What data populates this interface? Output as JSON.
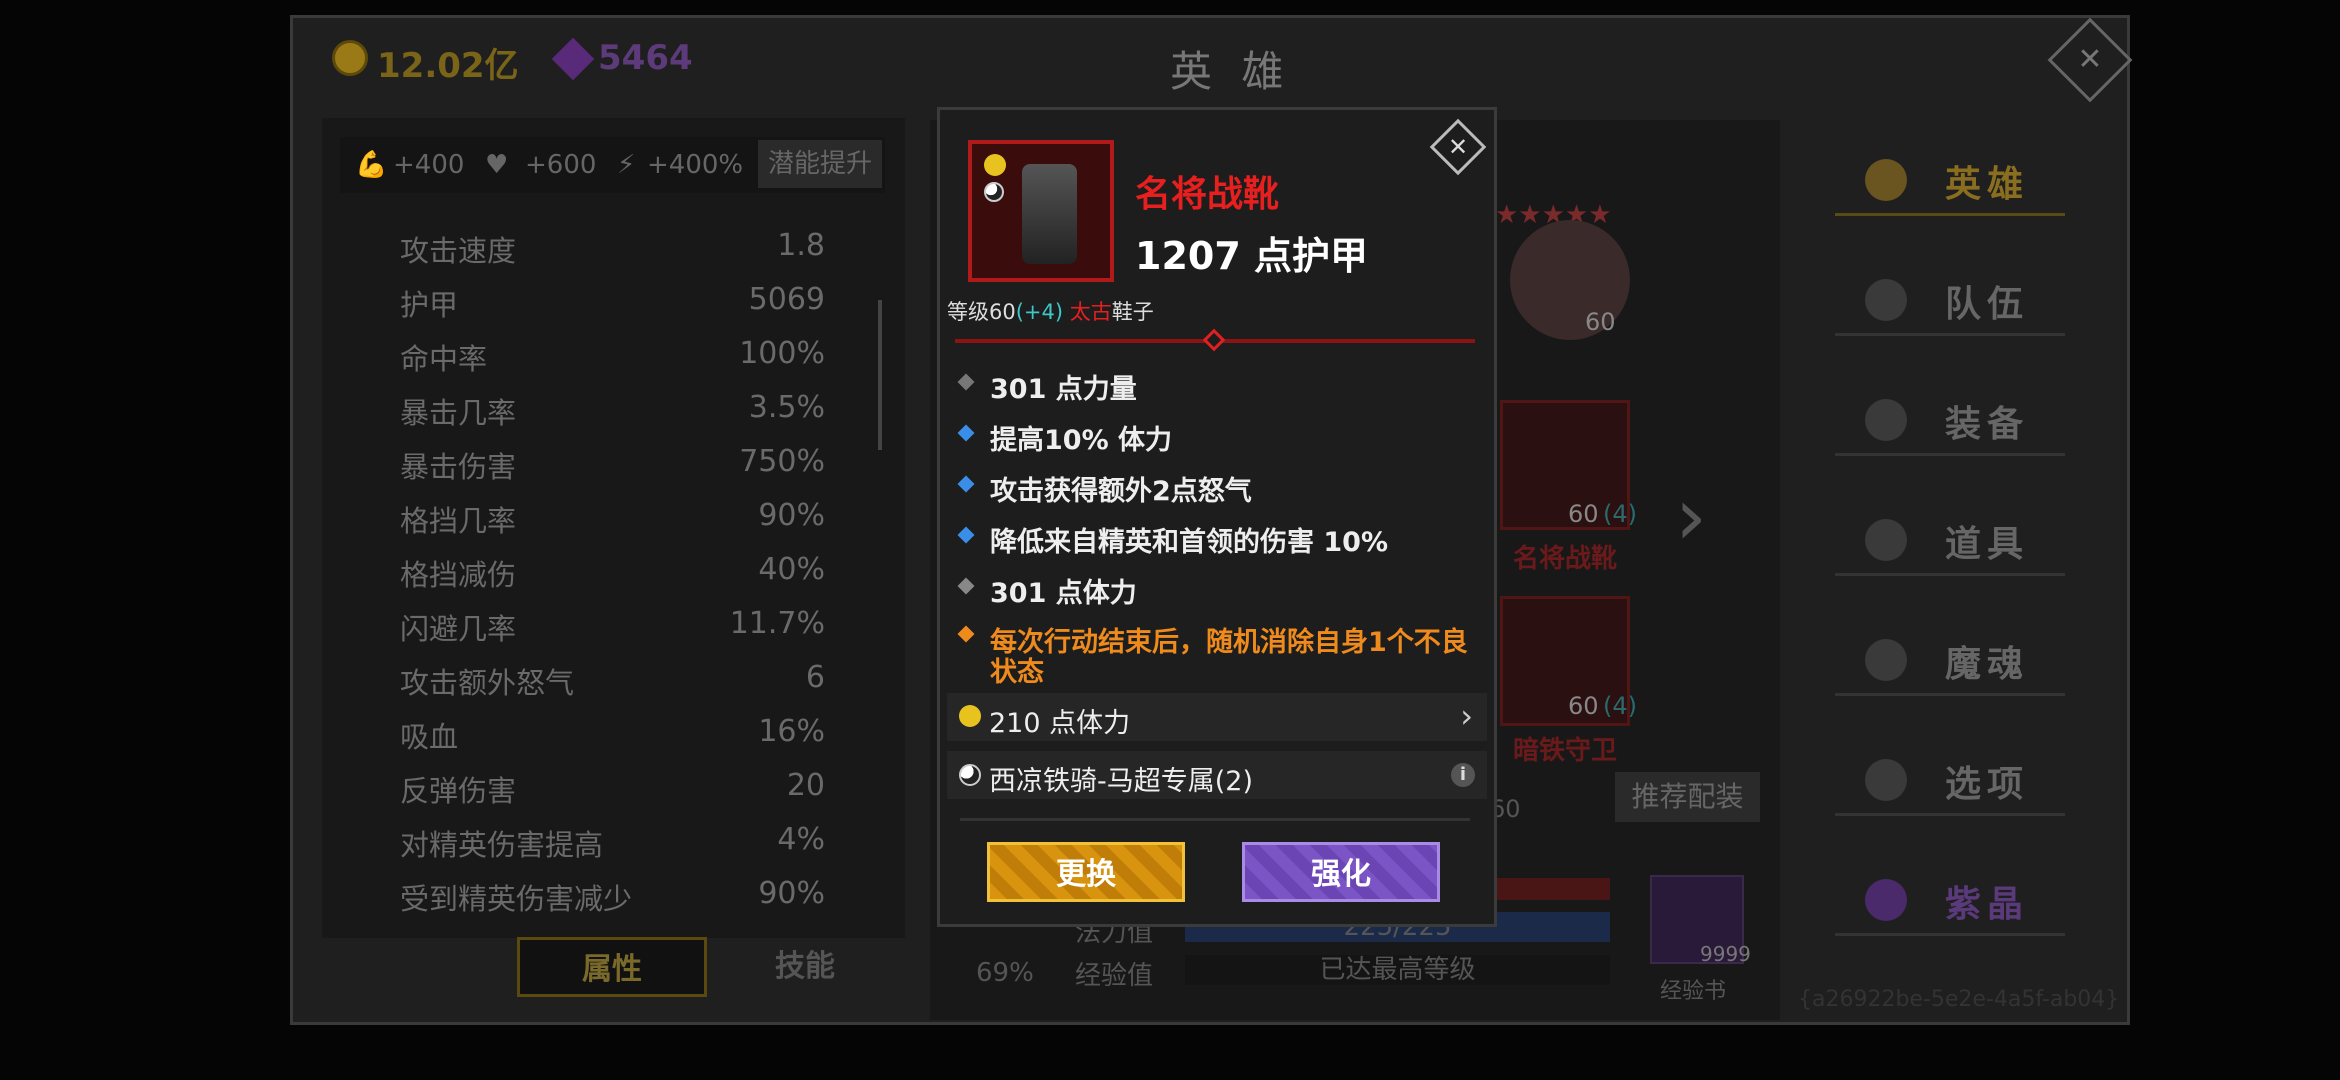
{
  "header": {
    "title": "英 雄",
    "gold": "12.02亿",
    "gems": "5464"
  },
  "buffs": {
    "strength": "+400",
    "health": "+600",
    "energy": "+400%",
    "potential_button": "潜能提升"
  },
  "stats": [
    {
      "label": "攻击速度",
      "value": "1.8"
    },
    {
      "label": "护甲",
      "value": "5069"
    },
    {
      "label": "命中率",
      "value": "100%"
    },
    {
      "label": "暴击几率",
      "value": "3.5%"
    },
    {
      "label": "暴击伤害",
      "value": "750%"
    },
    {
      "label": "格挡几率",
      "value": "90%"
    },
    {
      "label": "格挡减伤",
      "value": "40%"
    },
    {
      "label": "闪避几率",
      "value": "11.7%"
    },
    {
      "label": "攻击额外怒气",
      "value": "6"
    },
    {
      "label": "吸血",
      "value": "16%"
    },
    {
      "label": "反弹伤害",
      "value": "20"
    },
    {
      "label": "对精英伤害提高",
      "value": "4%"
    },
    {
      "label": "受到精英伤害减少",
      "value": "90%"
    }
  ],
  "tabs": {
    "attributes": "属性",
    "skills": "技能"
  },
  "center": {
    "hero_level": "60",
    "item1_level": "60",
    "item1_plus": "(4)",
    "item1_name": "名将战靴",
    "item2_level": "60",
    "item2_plus": "(4)",
    "item2_name": "暗铁守卫",
    "recommend_button": "推荐配装",
    "mana_label": "法力值",
    "mana_value": "225/225",
    "exp_label": "经验值",
    "exp_value": "已达最高等级",
    "percent": "69%",
    "book_count": "9999",
    "book_label": "经验书",
    "uuid_fragment": "{a26922be-5e2e-4a5f-ab04}",
    "arrow": "›",
    "extra_num": "60"
  },
  "nav": [
    {
      "label": "英雄",
      "active": true
    },
    {
      "label": "队伍",
      "active": false
    },
    {
      "label": "装备",
      "active": false
    },
    {
      "label": "道具",
      "active": false
    },
    {
      "label": "魔魂",
      "active": false
    },
    {
      "label": "选项",
      "active": false
    },
    {
      "label": "紫晶",
      "active": false
    }
  ],
  "modal": {
    "item_name": "名将战靴",
    "armor": "1207 点护甲",
    "level_text": "等级60",
    "level_bonus": "(+4)",
    "rarity": "太古",
    "slot": "鞋子",
    "props": [
      {
        "text": "301 点力量",
        "color": "#777777"
      },
      {
        "text": "提高10% 体力",
        "color": "#3a8ee8"
      },
      {
        "text": "攻击获得额外2点怒气",
        "color": "#3a8ee8"
      },
      {
        "text": "降低来自精英和首领的伤害 10%",
        "color": "#3a8ee8"
      },
      {
        "text": "301 点体力",
        "color": "#888888"
      }
    ],
    "orange_prop_line1": "每次行动结束后，随机消除自身1个不良",
    "orange_prop_line2": "状态",
    "gem_row": "210 点体力",
    "set_row": "西凉铁骑-马超专属(2)",
    "swap_button": "更换",
    "upgrade_button": "强化"
  },
  "colors": {
    "legendary_red": "#e81f1f",
    "orange": "#ef8a1c",
    "blue_bullet": "#3a8ee8",
    "gold": "#d9940f",
    "purple": "#7b54c6"
  }
}
